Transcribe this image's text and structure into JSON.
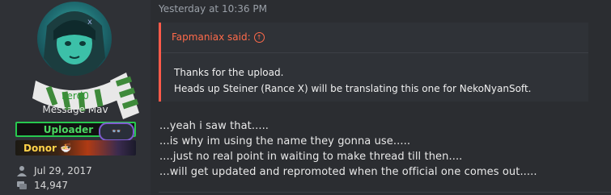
{
  "user": {
    "username": "Lerd0",
    "title": "Message Mav",
    "banners": {
      "uploader_label": "Uploader",
      "uploader_badge": "👓",
      "donor_label": "Donor",
      "donor_icon": "🍜"
    },
    "stats": {
      "joined": "Jul 29, 2017",
      "messages": "14,947"
    }
  },
  "post": {
    "timestamp": "Yesterday at 10:36 PM",
    "quote": {
      "author": "Fapmaniax said:",
      "arrow_icon": "up-arrow-circle-icon",
      "lines": [
        "Thanks for the upload.",
        "Heads up Steiner (Rance X) will be translating this one for NekoNyanSoft."
      ]
    },
    "lines": [
      "...yeah i saw that.....",
      "...is why im using the name they gonna use.....",
      "....just no real point in waiting to make thread till then....",
      "...will get updated and repromoted when the official one comes out....."
    ]
  },
  "colors": {
    "background": "#2b2d31",
    "quote_accent": "#ff5a4a",
    "username": "#2e9b35",
    "uploader_border": "#27c94f",
    "donor_text": "#ffd34a"
  }
}
